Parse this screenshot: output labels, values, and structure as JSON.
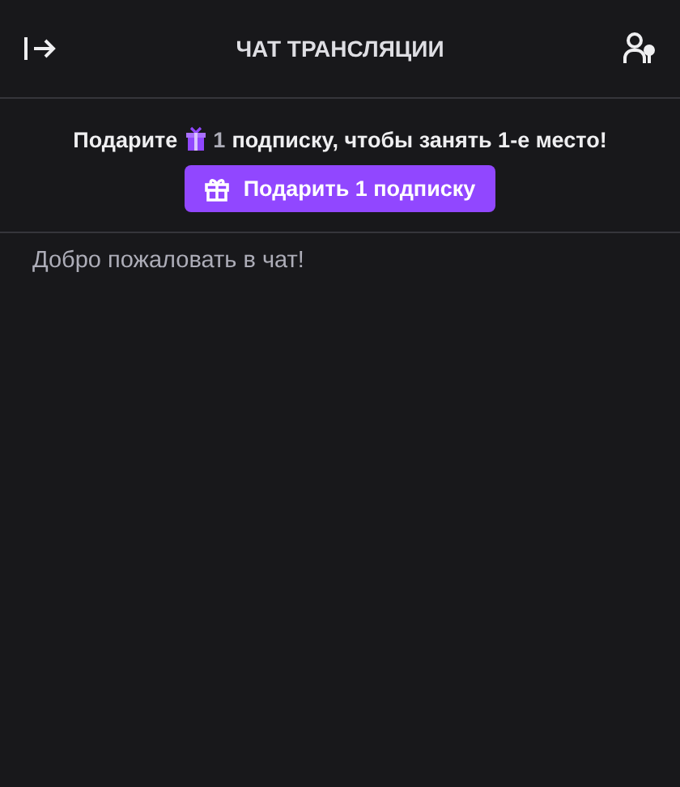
{
  "header": {
    "title": "ЧАТ ТРАНСЛЯЦИИ"
  },
  "promo": {
    "text_before": "Подарите",
    "count": "1",
    "text_after": "подписку, чтобы занять 1-е место!",
    "button": "Подарить 1 подписку"
  },
  "messages": [
    {
      "text": "Добро пожаловать в чат!"
    }
  ]
}
